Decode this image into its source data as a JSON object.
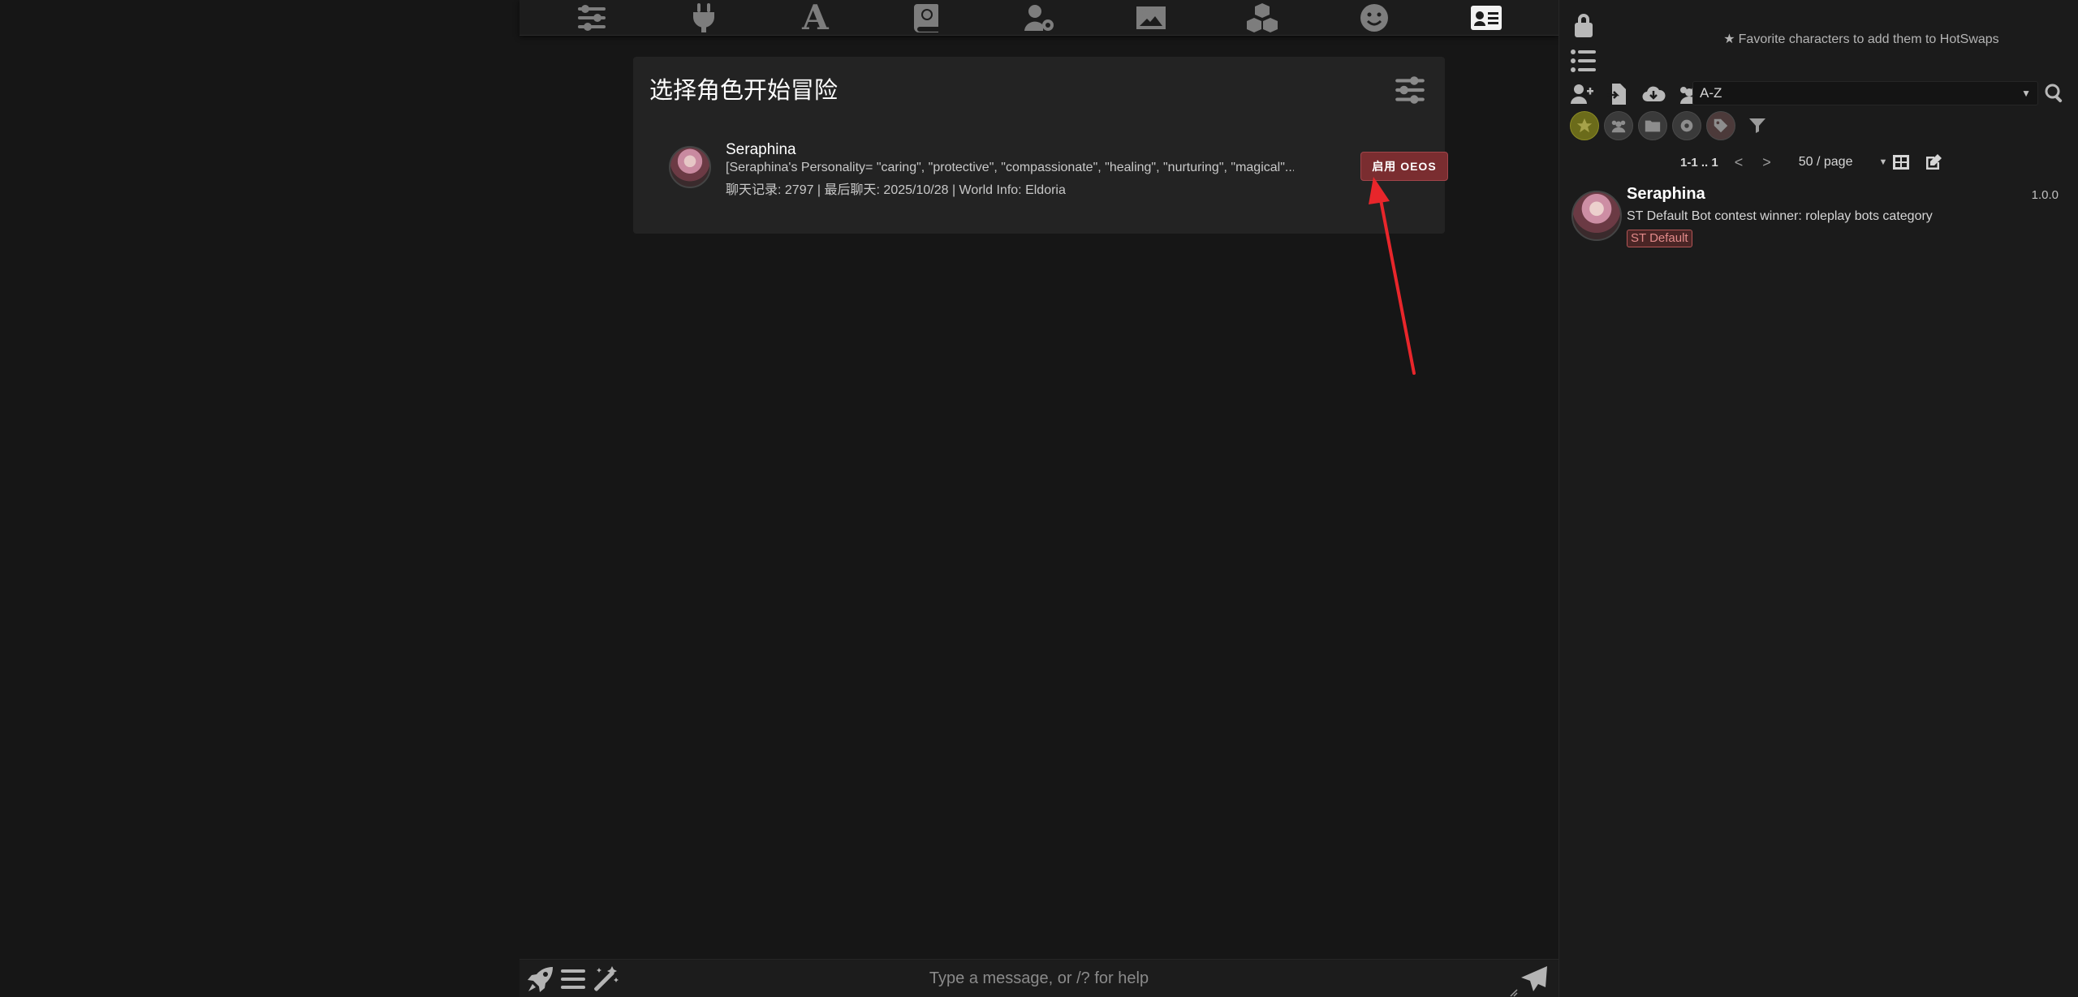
{
  "top_bar": {
    "icons": [
      "sliders-icon",
      "plug-icon",
      "font-a-icon",
      "book-atlas-icon",
      "user-gear-icon",
      "image-landscape-icon",
      "cubes-icon",
      "smiley-icon",
      "id-card-icon"
    ],
    "font_letter": "A"
  },
  "welcome": {
    "title": "选择角色开始冒险",
    "character": {
      "name": "Seraphina",
      "description": "[Seraphina's Personality= \"caring\", \"protective\", \"compassionate\", \"healing\", \"nurturing\", \"magical\"...",
      "meta": "聊天记录: 2797 | 最后聊天: 2025/10/28 | World Info: Eldoria",
      "button_label": "启用 OEOS"
    }
  },
  "right_panel": {
    "hotswap_hint": "Favorite characters to add them to HotSwaps",
    "sort": {
      "selected": "A-Z"
    },
    "pager": {
      "range": "1-1 .. 1",
      "prev": "<",
      "next": ">",
      "page_size": "50 / page"
    },
    "characters": [
      {
        "name": "Seraphina",
        "version": "1.0.0",
        "description": "ST Default Bot contest winner: roleplay bots category",
        "tag": "ST Default"
      }
    ]
  },
  "input_bar": {
    "placeholder": "Type a message, or /? for help"
  },
  "colors": {
    "background": "#161616",
    "panel": "#232323",
    "accent_button": "#7a2d30",
    "annotation_arrow": "#e8262b",
    "tag_border": "#b45656"
  }
}
